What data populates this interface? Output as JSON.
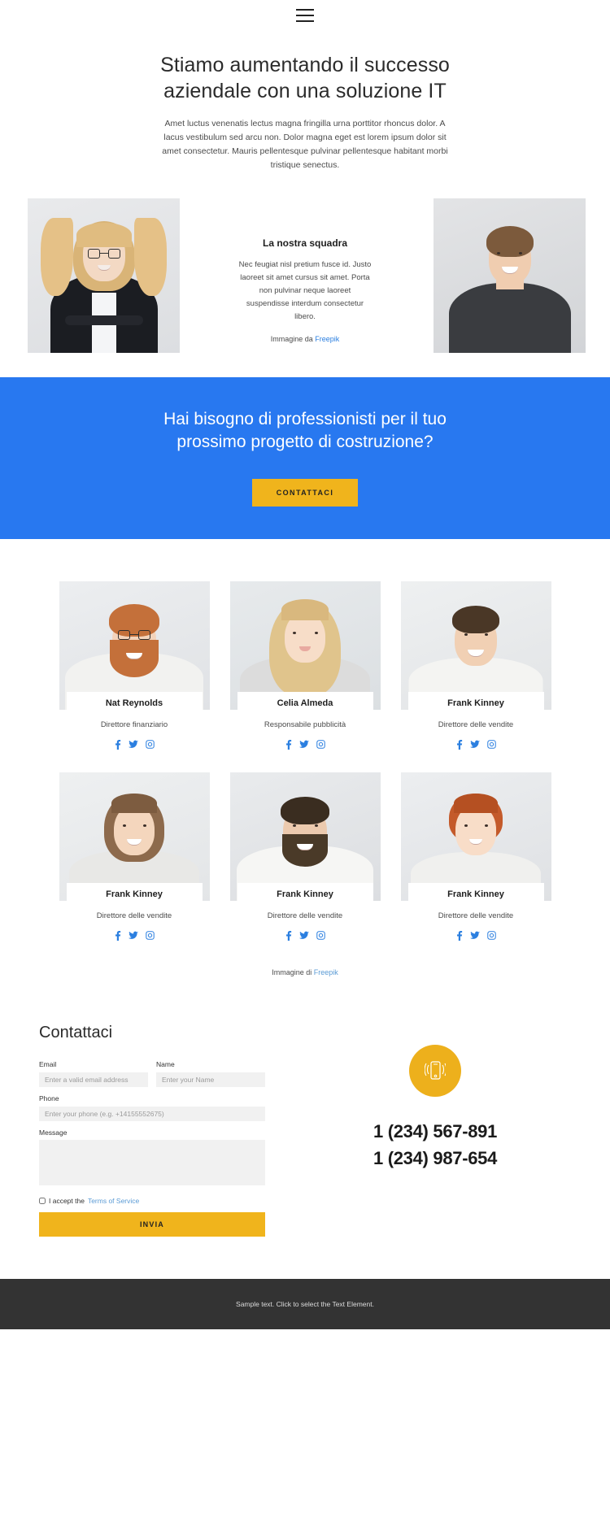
{
  "header": {
    "menu_icon": "hamburger-menu-icon"
  },
  "hero": {
    "title_line1": "Stiamo aumentando il successo",
    "title_line2": "aziendale con una soluzione IT",
    "paragraph": "Amet luctus venenatis lectus magna fringilla urna porttitor rhoncus dolor. A lacus vestibulum sed arcu non. Dolor magna eget est lorem ipsum dolor sit amet consectetur. Mauris pellentesque pulvinar pellentesque habitant morbi tristique senectus."
  },
  "intro": {
    "heading": "La nostra squadra",
    "paragraph": "Nec feugiat nisl pretium fusce id. Justo laoreet sit amet cursus sit amet. Porta non pulvinar neque laoreet suspendisse interdum consectetur libero.",
    "credit_prefix": "Immagine da",
    "credit_link": "Freepik"
  },
  "cta": {
    "heading_line1": "Hai bisogno di professionisti per il tuo",
    "heading_line2": "prossimo progetto di costruzione?",
    "button_label": "CONTATTACI",
    "background_color": "#2878f0",
    "button_color": "#f0b41c"
  },
  "team": {
    "members": [
      {
        "name": "Nat Reynolds",
        "role": "Direttore finanziario"
      },
      {
        "name": "Celia Almeda",
        "role": "Responsabile pubblicità"
      },
      {
        "name": "Frank Kinney",
        "role": "Direttore delle vendite"
      },
      {
        "name": "Frank Kinney",
        "role": "Direttore delle vendite"
      },
      {
        "name": "Frank Kinney",
        "role": "Direttore delle vendite"
      },
      {
        "name": "Frank Kinney",
        "role": "Direttore delle vendite"
      }
    ],
    "social_icons": [
      "facebook-icon",
      "twitter-icon",
      "instagram-icon"
    ],
    "credit_prefix": "Immagine di",
    "credit_link": "Freepik"
  },
  "contact": {
    "title": "Contattaci",
    "email_label": "Email",
    "email_placeholder": "Enter a valid email address",
    "name_label": "Name",
    "name_placeholder": "Enter your Name",
    "phone_label": "Phone",
    "phone_placeholder": "Enter your phone (e.g. +14155552675)",
    "message_label": "Message",
    "message_placeholder": "",
    "accept_text": "I accept the",
    "terms_link": "Terms of Service",
    "submit_label": "INVIA",
    "phone_number_1": "1 (234) 567-891",
    "phone_number_2": "1 (234) 987-654",
    "phone_icon": "mobile-phone-icon",
    "accent_color": "#edb01c"
  },
  "footer": {
    "text": "Sample text. Click to select the Text Element."
  }
}
